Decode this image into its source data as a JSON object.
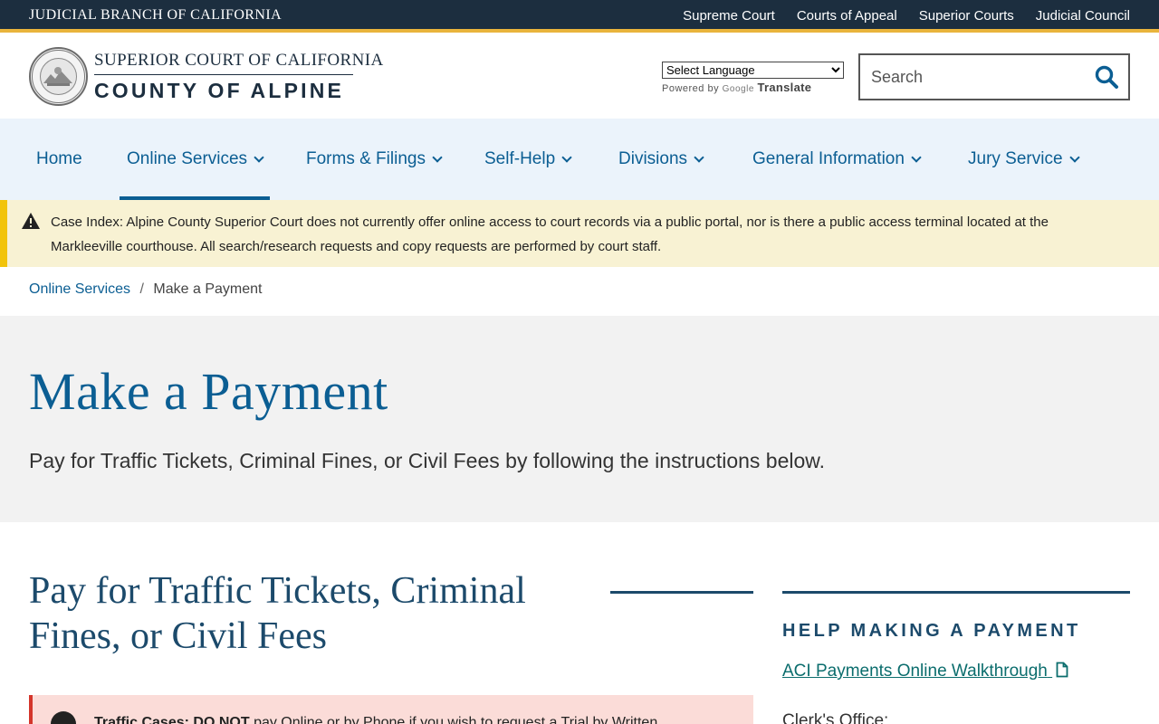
{
  "topbar": {
    "branch": "JUDICIAL BRANCH OF CALIFORNIA",
    "links": [
      "Supreme Court",
      "Courts of Appeal",
      "Superior Courts",
      "Judicial Council"
    ]
  },
  "header": {
    "court_line1": "SUPERIOR COURT OF CALIFORNIA",
    "court_line2": "COUNTY OF ALPINE",
    "seal_icon": "court-seal-logo",
    "translate": {
      "select_value": "Select Language",
      "powered": "Powered by",
      "google": "Google",
      "translate": "Translate"
    },
    "search": {
      "placeholder": "Search",
      "icon": "search-icon"
    }
  },
  "nav": {
    "items": [
      {
        "label": "Home"
      },
      {
        "label": "Online Services"
      },
      {
        "label": "Forms & Filings"
      },
      {
        "label": "Self-Help"
      },
      {
        "label": "Divisions"
      },
      {
        "label": "General Information"
      },
      {
        "label": "Jury Service"
      }
    ]
  },
  "alert": {
    "icon": "warning-icon",
    "label": "Case Index:",
    "text": "Alpine County Superior Court does not currently offer online access to court records via a public portal, nor is there a public access terminal located at the Markleeville courthouse. All search/research requests and copy requests are performed by court staff."
  },
  "breadcrumb": {
    "parent": "Online Services",
    "separator": "/",
    "current": "Make a Payment"
  },
  "hero": {
    "title": "Make a Payment",
    "subtitle": "Pay for Traffic Tickets, Criminal Fines, or Civil Fees by following the instructions below."
  },
  "content": {
    "section_title": "Pay for Traffic Tickets, Criminal Fines, or Civil Fees",
    "danger_bold1": "Traffic Cases:",
    "danger_bold2": "DO NOT",
    "danger_rest": "pay Online or by Phone if you wish to request a Trial by Written"
  },
  "sidebar": {
    "heading": "HELP MAKING A PAYMENT",
    "link": "ACI Payments Online Walkthrough",
    "link_icon": "document-icon",
    "clerk": "Clerk's Office:"
  },
  "colors": {
    "topbar": "#1c2e3f",
    "accent_gold": "#e9b43c",
    "link_blue": "#0b5e93",
    "alert_bg": "#f8f2d3",
    "danger_bg": "#fbdcd8"
  }
}
